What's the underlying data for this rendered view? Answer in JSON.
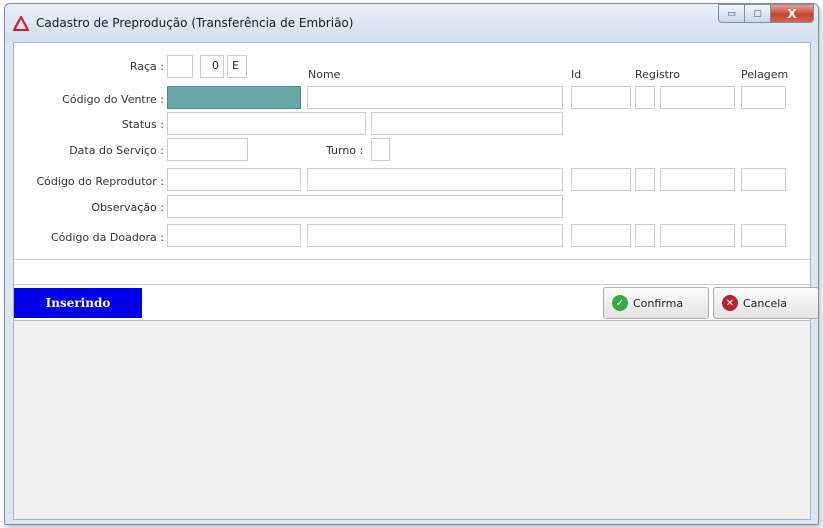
{
  "window": {
    "title": "Cadastro de Preprodução (Transferência de Embrião)",
    "controls": {
      "minimize": "▭",
      "maximize": "▢",
      "close": "X"
    }
  },
  "form": {
    "raca_label": "Raça :",
    "raca_num": "0",
    "raca_code": "E",
    "col_nome": "Nome",
    "col_id": "Id",
    "col_registro": "Registro",
    "col_pelagem": "Pelagem",
    "ventre_label": "Código do Ventre :",
    "status_label": "Status :",
    "data_servico_label": "Data do Serviço :",
    "turno_label": "Turno :",
    "reprodutor_label": "Código do Reprodutor :",
    "observacao_label": "Observação :",
    "doadora_label": "Código da Doadora :"
  },
  "footer": {
    "mode_badge": "Inserindo",
    "confirm_label": "Confirma",
    "cancel_label": "Cancela"
  },
  "colors": {
    "selected_field": "#68a9a7",
    "mode_badge": "#0000e6",
    "confirm_icon": "#3aa844",
    "cancel_icon": "#b3262b"
  },
  "icons": {
    "app": "warning-triangle-icon",
    "confirm": "check-circle-icon",
    "cancel": "x-circle-icon"
  }
}
